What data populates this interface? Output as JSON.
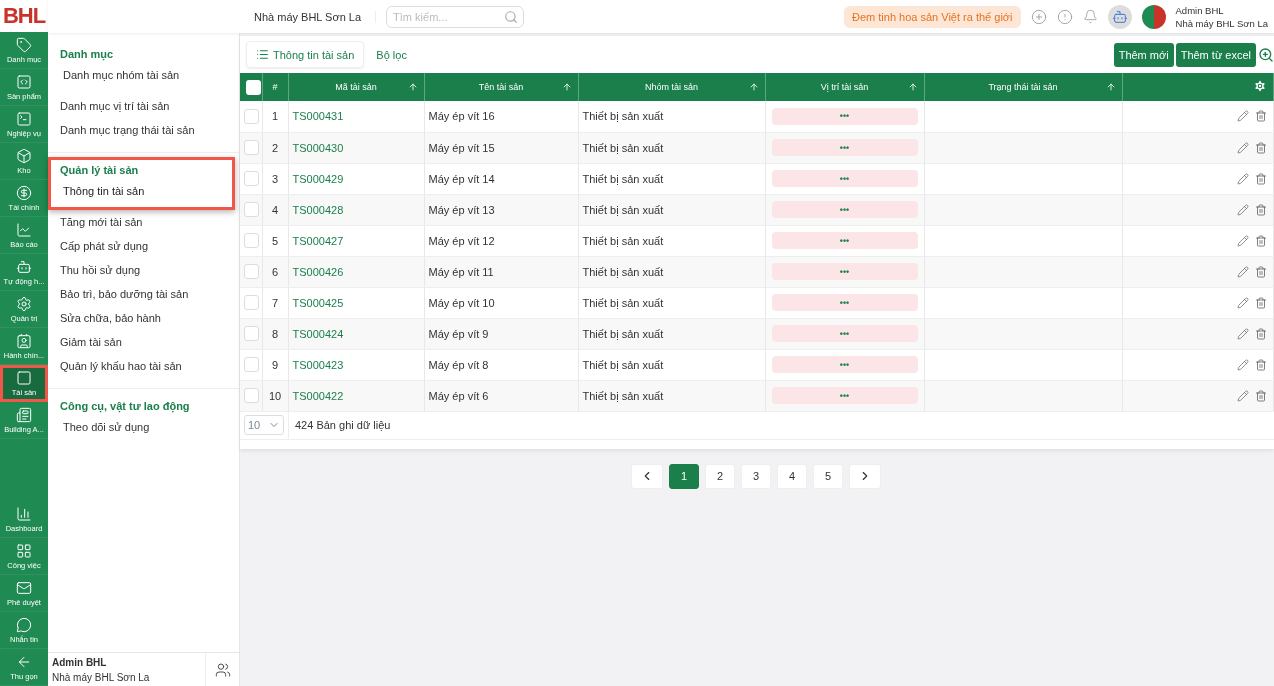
{
  "brand": {
    "logo": "BHL",
    "company": "Nhà máy BHL Sơn La"
  },
  "search": {
    "placeholder": "Tìm kiếm..."
  },
  "slogan": "Đem tinh hoa sản Việt ra thế giới",
  "user": {
    "name": "Admin BHL",
    "org": "Nhà máy BHL Sơn La"
  },
  "rail": {
    "items": [
      {
        "label": "Danh mục",
        "selected": false,
        "highlighted": false
      },
      {
        "label": "Sản phẩm",
        "selected": false,
        "highlighted": false
      },
      {
        "label": "Nghiệp vụ",
        "selected": false,
        "highlighted": false
      },
      {
        "label": "Kho",
        "selected": false,
        "highlighted": false
      },
      {
        "label": "Tài chính",
        "selected": false,
        "highlighted": false
      },
      {
        "label": "Báo cáo",
        "selected": false,
        "highlighted": false
      },
      {
        "label": "Tự động h...",
        "selected": false,
        "highlighted": false
      },
      {
        "label": "Quản trị",
        "selected": false,
        "highlighted": false
      },
      {
        "label": "Hành chín...",
        "selected": false,
        "highlighted": false
      },
      {
        "label": "Tài sản",
        "selected": true,
        "highlighted": true
      },
      {
        "label": "Building A...",
        "selected": false,
        "highlighted": false
      }
    ],
    "bottom": [
      {
        "label": "Dashboard"
      },
      {
        "label": "Công việc"
      },
      {
        "label": "Phê duyệt"
      },
      {
        "label": "Nhắn tin"
      },
      {
        "label": "Thu gọn"
      }
    ]
  },
  "menu": {
    "sections": [
      {
        "title": "Danh mục",
        "highlighted": false,
        "items": [
          {
            "label": "Danh mục nhóm tài sản",
            "selected": false
          },
          {
            "label": "Danh mục vị trí tài sản",
            "selected": false
          },
          {
            "label": "Danh mục trạng thái tài sản",
            "selected": false
          }
        ]
      },
      {
        "title": "Quản lý tài sản",
        "highlighted": true,
        "items": [
          {
            "label": "Thông tin tài sản",
            "selected": true
          },
          {
            "label": "Tăng mới tài sản",
            "selected": false
          },
          {
            "label": "Cấp phát sử dụng",
            "selected": false
          },
          {
            "label": "Thu hồi sử dụng",
            "selected": false
          },
          {
            "label": "Bảo trì, bảo dưỡng tài sản",
            "selected": false
          },
          {
            "label": "Sửa chữa, bảo hành",
            "selected": false
          },
          {
            "label": "Giảm tài sản",
            "selected": false
          },
          {
            "label": "Quản lý khấu hao tài sản",
            "selected": false
          }
        ]
      },
      {
        "title": "Công cụ, vật tư lao động",
        "highlighted": false,
        "items": [
          {
            "label": "Theo dõi sử dụng",
            "selected": false
          }
        ]
      }
    ],
    "footer": {
      "name": "Admin BHL",
      "org": "Nhà máy BHL Sơn La"
    }
  },
  "toolbar": {
    "tabs": [
      {
        "label": "Thông tin tài sản",
        "selected": true
      },
      {
        "label": "Bộ lọc",
        "selected": false
      }
    ],
    "buttons": [
      "Thêm mới",
      "Thêm từ excel"
    ]
  },
  "table": {
    "select_all": {
      "checked": false
    },
    "columns": [
      "#",
      "Mã tài sản",
      "Tên tài sản",
      "Nhóm tài sản",
      "Vị trí tài sản",
      "Trạng thái tài sản"
    ],
    "rows": [
      {
        "index": "1",
        "code": "TS000431",
        "name": "Máy ép vít 16",
        "group": "Thiết bị sản xuất",
        "location": "•••",
        "checked": false
      },
      {
        "index": "2",
        "code": "TS000430",
        "name": "Máy ép vít 15",
        "group": "Thiết bị sản xuất",
        "location": "•••",
        "checked": false
      },
      {
        "index": "3",
        "code": "TS000429",
        "name": "Máy ép vít 14",
        "group": "Thiết bị sản xuất",
        "location": "•••",
        "checked": false
      },
      {
        "index": "4",
        "code": "TS000428",
        "name": "Máy ép vít 13",
        "group": "Thiết bị sản xuất",
        "location": "•••",
        "checked": false
      },
      {
        "index": "5",
        "code": "TS000427",
        "name": "Máy ép vít 12",
        "group": "Thiết bị sản xuất",
        "location": "•••",
        "checked": false
      },
      {
        "index": "6",
        "code": "TS000426",
        "name": "Máy ép vít 11",
        "group": "Thiết bị sản xuất",
        "location": "•••",
        "checked": false
      },
      {
        "index": "7",
        "code": "TS000425",
        "name": "Máy ép vít 10",
        "group": "Thiết bị sản xuất",
        "location": "•••",
        "checked": false
      },
      {
        "index": "8",
        "code": "TS000424",
        "name": "Máy ép vít 9",
        "group": "Thiết bị sản xuất",
        "location": "•••",
        "checked": false
      },
      {
        "index": "9",
        "code": "TS000423",
        "name": "Máy ép vít 8",
        "group": "Thiết bị sản xuất",
        "location": "•••",
        "checked": false
      },
      {
        "index": "10",
        "code": "TS000422",
        "name": "Máy ép vít 6",
        "group": "Thiết bị sản xuất",
        "location": "•••",
        "checked": false
      }
    ],
    "page_size": "10",
    "total": "424 Bản ghi dữ liệu"
  },
  "pagination": {
    "pages": [
      {
        "label": "1",
        "selected": true
      },
      {
        "label": "2",
        "selected": false
      },
      {
        "label": "3",
        "selected": false
      },
      {
        "label": "4",
        "selected": false
      },
      {
        "label": "5",
        "selected": false
      }
    ]
  }
}
